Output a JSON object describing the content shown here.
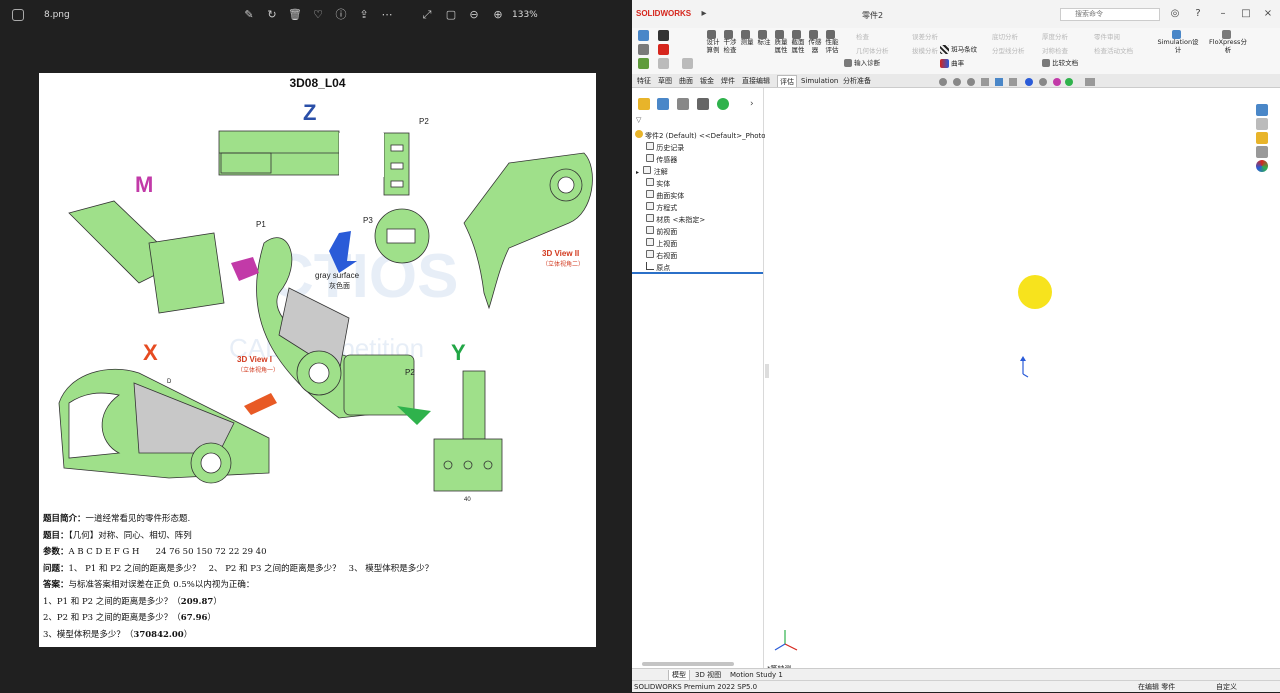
{
  "viewer": {
    "file_name": "8.png",
    "zoom": "133%",
    "icons": [
      "app-icon",
      "edit-icon",
      "rotate-icon",
      "delete-icon",
      "favorite-icon",
      "info-icon",
      "share-icon",
      "more-icon",
      "fullscreen-icon",
      "fit-icon",
      "zoom-out-icon",
      "zoom-in-icon"
    ],
    "document": {
      "title": "3D08_L04",
      "view_letters": {
        "z": "Z",
        "m": "M",
        "x": "X",
        "y": "Y"
      },
      "labels": {
        "p1": "P1",
        "p2": "P2",
        "p2b": "P2",
        "p3": "P3",
        "gray_surface": "gray surface",
        "gray_surface_cn": "灰色面",
        "view1": "3D View I",
        "view1_cn": "（立体视角一）",
        "view2": "3D View II",
        "view2_cn": "（立体视角二）",
        "dim_d": "D",
        "dim_40": "40"
      },
      "watermark": {
        "logo": "CTIOS",
        "sub": "CAD competition"
      },
      "text_rows": [
        {
          "label": "题目简介：",
          "text": "一道经常看见的零件形态题."
        },
        {
          "label": "题目：",
          "text": "【几何】对称、同心、相切、阵列"
        },
        {
          "label": "参数：",
          "text": "A B C D E F G H      24 76 50 150 72 22 29 40"
        },
        {
          "label": "问题：",
          "text": "1、 P1 和 P2 之间的距离是多少？   2、 P2 和 P3 之间的距离是多少？   3、 模型体积是多少？"
        },
        {
          "label": "答案：",
          "text": "与标准答案相对误差在正负 0.5%以内视为正确："
        },
        {
          "label": "",
          "text": "1、P1 和 P2 之间的距离是多少？（",
          "answer": "209.87",
          "tail": "）"
        },
        {
          "label": "",
          "text": "2、P2 和 P3 之间的距离是多少？（",
          "answer": "67.96",
          "tail": "）"
        },
        {
          "label": "",
          "text": "3、模型体积是多少？（",
          "answer": "370842.00",
          "tail": "）"
        }
      ]
    }
  },
  "solidworks": {
    "brand": "SOLIDWORKS",
    "doc_title": "零件2",
    "search_placeholder": "搜索命令",
    "ribbon": [
      {
        "id": "design-study",
        "label": "设计算例"
      },
      {
        "id": "interference",
        "label": "干涉检查"
      },
      {
        "id": "measure",
        "label": "测量"
      },
      {
        "id": "markup",
        "label": "标注"
      },
      {
        "id": "mass-props",
        "label": "质量属性"
      },
      {
        "id": "section-props",
        "label": "截面属性"
      },
      {
        "id": "sensor",
        "label": "传感器"
      },
      {
        "id": "perf-eval",
        "label": "性能评估"
      }
    ],
    "ribbon_grey": [
      "检查",
      "几何体分析",
      "输入诊断",
      "误差分析",
      "拔模分析",
      "底切分析",
      "分型线分析",
      "厚度分析",
      "对称检查",
      "比较文档",
      "零件审阅",
      "检查活动文档",
      "曲率",
      "斑马条纹",
      "Simulation 设计",
      "FloXpress 分析"
    ],
    "ribbon_active": {
      "import_diag": "输入诊断",
      "zebra": "斑马条纹",
      "curvature": "曲率",
      "compare": "比较文档",
      "sim_design": "Simulation设计",
      "floxpress": "FloXpress分析"
    },
    "tabs": [
      "特征",
      "草图",
      "曲面",
      "钣金",
      "焊件",
      "直接编辑",
      "评估",
      "Simulation",
      "分析准备"
    ],
    "active_tab": "评估",
    "tree_root": "零件2 (Default) <<Default>_Photo\\",
    "tree_items": [
      "历史记录",
      "传感器",
      "注解",
      "实体",
      "曲面实体",
      "方程式",
      "材质 <未指定>",
      "前视面",
      "上视面",
      "右视面",
      "原点"
    ],
    "view_label": "*等轴测",
    "bottom_tabs": [
      "模型",
      "3D 视图",
      "Motion Study 1"
    ],
    "active_bottom_tab": "模型",
    "status_left": "SOLIDWORKS Premium 2022 SP5.0",
    "status_mid": "在编辑 零件",
    "status_right": "自定义",
    "colors": {
      "accent": "#2b70c8",
      "brand_red": "#d6261d",
      "highlight": "#f7e31d"
    }
  }
}
